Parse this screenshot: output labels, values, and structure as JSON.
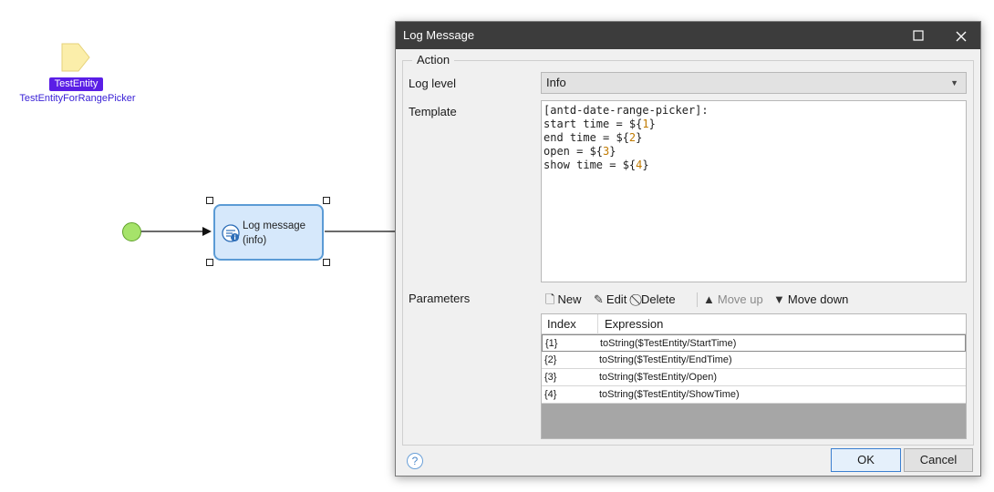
{
  "canvas": {
    "parameter": {
      "type_badge": "TestEntity",
      "name": "TestEntityForRangePicker"
    },
    "activity": {
      "line1": "Log message",
      "line2": "(info)"
    }
  },
  "dialog": {
    "title": "Log Message",
    "maximize_icon": "maximize-icon",
    "close_icon": "close-icon",
    "group_label": "Action",
    "log_level": {
      "label": "Log level",
      "value": "Info"
    },
    "template": {
      "label": "Template",
      "lines": [
        {
          "text": "[antd-date-range-picker]:",
          "num": ""
        },
        {
          "text": "start time = ${",
          "num": "1",
          "end": "}"
        },
        {
          "text": "end time = ${",
          "num": "2",
          "end": "}"
        },
        {
          "text": "open = ${",
          "num": "3",
          "end": "}"
        },
        {
          "text": "show time = ${",
          "num": "4",
          "end": "}"
        }
      ]
    },
    "parameters": {
      "label": "Parameters",
      "toolbar": {
        "new": "New",
        "edit": "Edit",
        "delete": "Delete",
        "move_up": "Move up",
        "move_down": "Move down"
      },
      "columns": [
        "Index",
        "Expression"
      ],
      "rows": [
        {
          "index": "{1}",
          "expression": "toString($TestEntity/StartTime)"
        },
        {
          "index": "{2}",
          "expression": "toString($TestEntity/EndTime)"
        },
        {
          "index": "{3}",
          "expression": "toString($TestEntity/Open)"
        },
        {
          "index": "{4}",
          "expression": "toString($TestEntity/ShowTime)"
        }
      ]
    },
    "buttons": {
      "ok": "OK",
      "cancel": "Cancel"
    },
    "help_glyph": "?"
  },
  "colors": {
    "entity_badge": "#5a1ee6",
    "entity_name": "#3a22d6",
    "start_event": "#a6e36a",
    "activity_fill": "#d6e8fb",
    "activity_border": "#5b9bd5",
    "titlebar": "#3c3c3c"
  }
}
